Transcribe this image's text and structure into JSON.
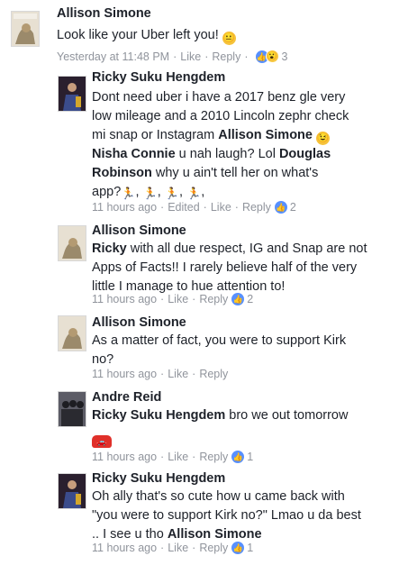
{
  "comments": [
    {
      "name": "Allison Simone",
      "lines": [
        "Look like your Uber left you!"
      ],
      "emoji": "neutral-face",
      "time": "Yesterday at 11:48 PM",
      "like": "Like",
      "reply": "Reply",
      "reaction_count": "3"
    },
    {
      "name": "Ricky Suku Hengdem",
      "lines": [
        "Dont need uber i have a 2017 benz  gle very",
        "low mileage and a 2010 Lincoln zephr check",
        "mi snap or Instagram"
      ],
      "mention1": "Allison Simone",
      "mention2": "Nisha Connie",
      "mid1": " u nah laugh? Lol ",
      "mention3": "Douglas",
      "mention3b": "Robinson",
      "mid2": " why u ain't tell her on what's",
      "last": "app?",
      "time": "11 hours ago",
      "edited": "Edited",
      "like": "Like",
      "reply": "Reply",
      "reaction_count": "2"
    },
    {
      "name": "Allison Simone",
      "mention": "Ricky",
      "line1": " with all due respect, IG and Snap are not",
      "line2": "Apps of Facts!! I rarely believe half of the very",
      "line3": "little I manage to hue attention to!",
      "time": "11 hours ago",
      "like": "Like",
      "reply": "Reply",
      "reaction_count": "2"
    },
    {
      "name": "Allison Simone",
      "line1": "As a matter of fact, you were to support Kirk",
      "line2": "no?",
      "time": "11 hours ago",
      "like": "Like",
      "reply": "Reply"
    },
    {
      "name": "Andre Reid",
      "mention": "Ricky Suku Hengdem",
      "line1": " bro we out tomorrow",
      "time": "11 hours ago",
      "like": "Like",
      "reply": "Reply",
      "reaction_count": "1"
    },
    {
      "name": "Ricky Suku Hengdem",
      "line1": "Oh ally that's so cute how u came back with",
      "line2": "\"you were to support Kirk no?\" Lmao u da best",
      "line3": ".. I see u tho ",
      "mention": "Allison Simone",
      "time": "11 hours ago",
      "like": "Like",
      "reply": "Reply",
      "reaction_count": "1"
    }
  ],
  "separator": "·",
  "icons": {
    "like": "thumbs-up-icon",
    "wow": "wow-face-icon",
    "runner": "person-running-emoji",
    "car": "red-car-emoji"
  },
  "colors": {
    "name": "#1d2129",
    "meta": "#90949c",
    "like_blue": "#5890ff"
  }
}
